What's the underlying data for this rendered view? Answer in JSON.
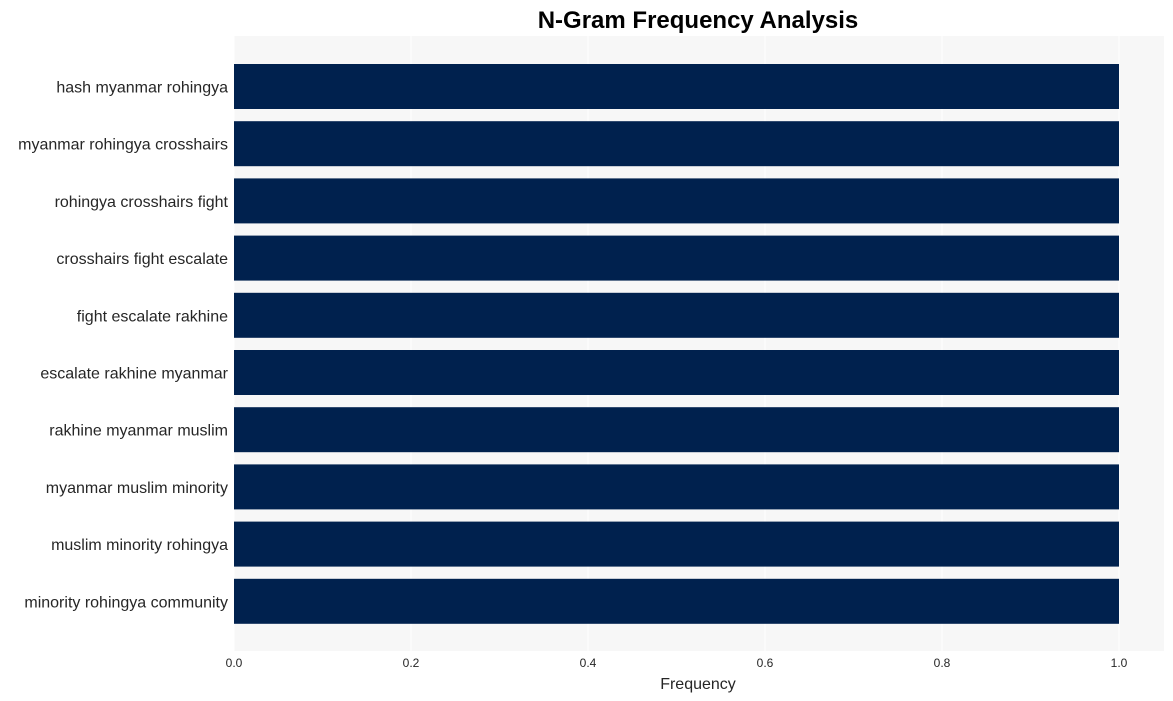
{
  "chart_data": {
    "type": "bar",
    "orientation": "horizontal",
    "title": "N-Gram Frequency Analysis",
    "xlabel": "Frequency",
    "ylabel": "",
    "xlim": [
      0,
      1.05
    ],
    "xticks": [
      0.0,
      0.2,
      0.4,
      0.6,
      0.8,
      1.0
    ],
    "xtick_labels": [
      "0.0",
      "0.2",
      "0.4",
      "0.6",
      "0.8",
      "1.0"
    ],
    "grid": true,
    "categories": [
      "hash myanmar rohingya",
      "myanmar rohingya crosshairs",
      "rohingya crosshairs fight",
      "crosshairs fight escalate",
      "fight escalate rakhine",
      "escalate rakhine myanmar",
      "rakhine myanmar muslim",
      "myanmar muslim minority",
      "muslim minority rohingya",
      "minority rohingya community"
    ],
    "values": [
      1,
      1,
      1,
      1,
      1,
      1,
      1,
      1,
      1,
      1
    ],
    "colors": {
      "bar": "#00214e",
      "plot_background": "#f7f7f7",
      "grid": "#ffffff"
    }
  }
}
